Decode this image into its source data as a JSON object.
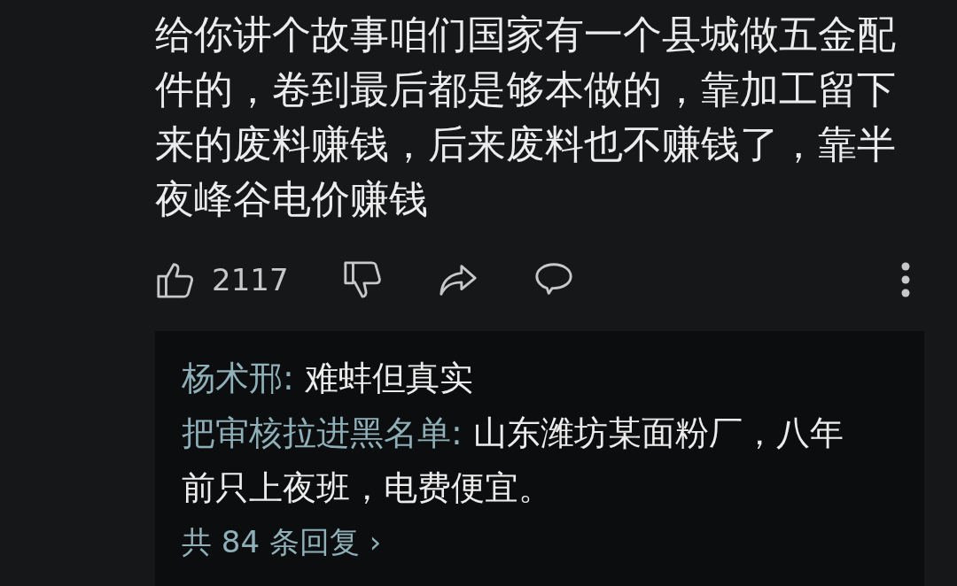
{
  "comment": {
    "text": "给你讲个故事咱们国家有一个县城做五金配件的，卷到最后都是够本做的，靠加工留下来的废料赚钱，后来废料也不赚钱了，靠半夜峰谷电价赚钱"
  },
  "actions": {
    "like_count": "2117"
  },
  "replies": [
    {
      "author": "杨术邢:",
      "text": "难蚌但真实"
    },
    {
      "author": "把审核拉进黑名单:",
      "text": "山东潍坊某面粉厂，八年前只上夜班，电费便宜。"
    }
  ],
  "more_replies": {
    "label": "共 84 条回复",
    "chevron": "›"
  }
}
